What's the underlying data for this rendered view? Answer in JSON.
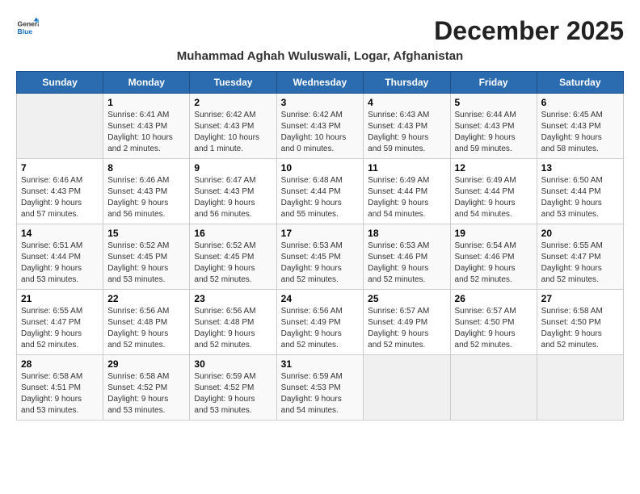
{
  "logo": {
    "line1": "General",
    "line2": "Blue"
  },
  "title": "December 2025",
  "subtitle": "Muhammad Aghah Wuluswali, Logar, Afghanistan",
  "days_of_week": [
    "Sunday",
    "Monday",
    "Tuesday",
    "Wednesday",
    "Thursday",
    "Friday",
    "Saturday"
  ],
  "weeks": [
    [
      {
        "day": "",
        "info": ""
      },
      {
        "day": "1",
        "info": "Sunrise: 6:41 AM\nSunset: 4:43 PM\nDaylight: 10 hours\nand 2 minutes."
      },
      {
        "day": "2",
        "info": "Sunrise: 6:42 AM\nSunset: 4:43 PM\nDaylight: 10 hours\nand 1 minute."
      },
      {
        "day": "3",
        "info": "Sunrise: 6:42 AM\nSunset: 4:43 PM\nDaylight: 10 hours\nand 0 minutes."
      },
      {
        "day": "4",
        "info": "Sunrise: 6:43 AM\nSunset: 4:43 PM\nDaylight: 9 hours\nand 59 minutes."
      },
      {
        "day": "5",
        "info": "Sunrise: 6:44 AM\nSunset: 4:43 PM\nDaylight: 9 hours\nand 59 minutes."
      },
      {
        "day": "6",
        "info": "Sunrise: 6:45 AM\nSunset: 4:43 PM\nDaylight: 9 hours\nand 58 minutes."
      }
    ],
    [
      {
        "day": "7",
        "info": "Sunrise: 6:46 AM\nSunset: 4:43 PM\nDaylight: 9 hours\nand 57 minutes."
      },
      {
        "day": "8",
        "info": "Sunrise: 6:46 AM\nSunset: 4:43 PM\nDaylight: 9 hours\nand 56 minutes."
      },
      {
        "day": "9",
        "info": "Sunrise: 6:47 AM\nSunset: 4:43 PM\nDaylight: 9 hours\nand 56 minutes."
      },
      {
        "day": "10",
        "info": "Sunrise: 6:48 AM\nSunset: 4:44 PM\nDaylight: 9 hours\nand 55 minutes."
      },
      {
        "day": "11",
        "info": "Sunrise: 6:49 AM\nSunset: 4:44 PM\nDaylight: 9 hours\nand 54 minutes."
      },
      {
        "day": "12",
        "info": "Sunrise: 6:49 AM\nSunset: 4:44 PM\nDaylight: 9 hours\nand 54 minutes."
      },
      {
        "day": "13",
        "info": "Sunrise: 6:50 AM\nSunset: 4:44 PM\nDaylight: 9 hours\nand 53 minutes."
      }
    ],
    [
      {
        "day": "14",
        "info": "Sunrise: 6:51 AM\nSunset: 4:44 PM\nDaylight: 9 hours\nand 53 minutes."
      },
      {
        "day": "15",
        "info": "Sunrise: 6:52 AM\nSunset: 4:45 PM\nDaylight: 9 hours\nand 53 minutes."
      },
      {
        "day": "16",
        "info": "Sunrise: 6:52 AM\nSunset: 4:45 PM\nDaylight: 9 hours\nand 52 minutes."
      },
      {
        "day": "17",
        "info": "Sunrise: 6:53 AM\nSunset: 4:45 PM\nDaylight: 9 hours\nand 52 minutes."
      },
      {
        "day": "18",
        "info": "Sunrise: 6:53 AM\nSunset: 4:46 PM\nDaylight: 9 hours\nand 52 minutes."
      },
      {
        "day": "19",
        "info": "Sunrise: 6:54 AM\nSunset: 4:46 PM\nDaylight: 9 hours\nand 52 minutes."
      },
      {
        "day": "20",
        "info": "Sunrise: 6:55 AM\nSunset: 4:47 PM\nDaylight: 9 hours\nand 52 minutes."
      }
    ],
    [
      {
        "day": "21",
        "info": "Sunrise: 6:55 AM\nSunset: 4:47 PM\nDaylight: 9 hours\nand 52 minutes."
      },
      {
        "day": "22",
        "info": "Sunrise: 6:56 AM\nSunset: 4:48 PM\nDaylight: 9 hours\nand 52 minutes."
      },
      {
        "day": "23",
        "info": "Sunrise: 6:56 AM\nSunset: 4:48 PM\nDaylight: 9 hours\nand 52 minutes."
      },
      {
        "day": "24",
        "info": "Sunrise: 6:56 AM\nSunset: 4:49 PM\nDaylight: 9 hours\nand 52 minutes."
      },
      {
        "day": "25",
        "info": "Sunrise: 6:57 AM\nSunset: 4:49 PM\nDaylight: 9 hours\nand 52 minutes."
      },
      {
        "day": "26",
        "info": "Sunrise: 6:57 AM\nSunset: 4:50 PM\nDaylight: 9 hours\nand 52 minutes."
      },
      {
        "day": "27",
        "info": "Sunrise: 6:58 AM\nSunset: 4:50 PM\nDaylight: 9 hours\nand 52 minutes."
      }
    ],
    [
      {
        "day": "28",
        "info": "Sunrise: 6:58 AM\nSunset: 4:51 PM\nDaylight: 9 hours\nand 53 minutes."
      },
      {
        "day": "29",
        "info": "Sunrise: 6:58 AM\nSunset: 4:52 PM\nDaylight: 9 hours\nand 53 minutes."
      },
      {
        "day": "30",
        "info": "Sunrise: 6:59 AM\nSunset: 4:52 PM\nDaylight: 9 hours\nand 53 minutes."
      },
      {
        "day": "31",
        "info": "Sunrise: 6:59 AM\nSunset: 4:53 PM\nDaylight: 9 hours\nand 54 minutes."
      },
      {
        "day": "",
        "info": ""
      },
      {
        "day": "",
        "info": ""
      },
      {
        "day": "",
        "info": ""
      }
    ]
  ]
}
